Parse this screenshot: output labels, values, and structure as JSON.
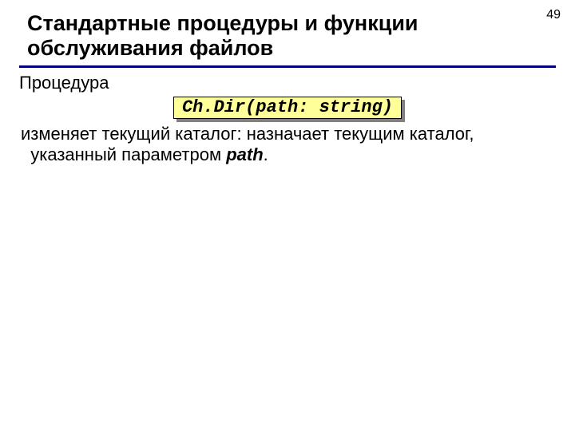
{
  "page_number": "49",
  "title_line1": "Стандартные процедуры и функции",
  "title_line2": "обслуживания файлов",
  "label": "Процедура",
  "code": "Ch.Dir(path: string)",
  "desc": {
    "part1": "изменяет текущий каталог: назначает текущим каталог,",
    "indent_part2_prefix": "указанный параметром ",
    "path_word": "path",
    "period": "."
  }
}
